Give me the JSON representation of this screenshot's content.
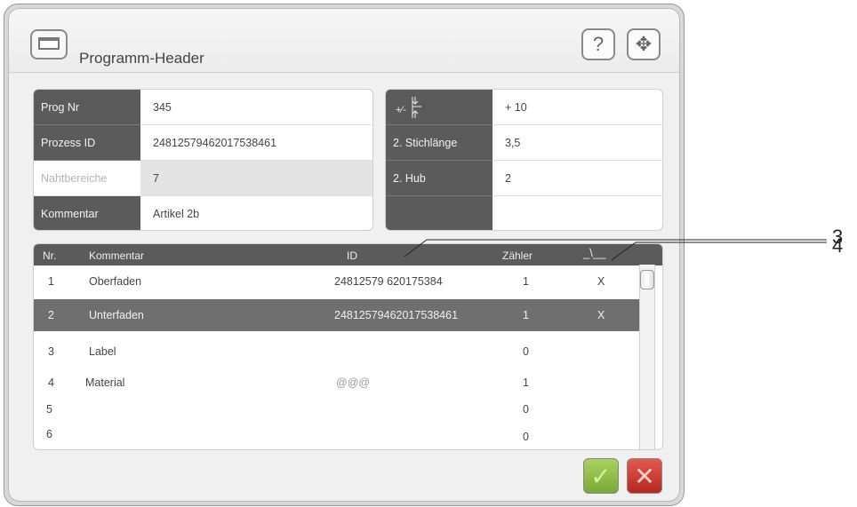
{
  "header": {
    "title": "Programm-Header",
    "help_icon": "?",
    "move_icon": "✥"
  },
  "left_table": [
    {
      "label": "Prog Nr",
      "value": "345"
    },
    {
      "label": "Prozess ID",
      "value": "24812579462017538461"
    },
    {
      "label": "Nahtbereiche",
      "value": "7"
    },
    {
      "label": "Kommentar",
      "value": "Artikel 2b"
    }
  ],
  "right_table": [
    {
      "label": "+/- stitch icon",
      "value": "+ 10"
    },
    {
      "label": "2. Stichlänge",
      "value": "3,5"
    },
    {
      "label": "2. Hub",
      "value": "2"
    },
    {
      "label": "",
      "value": ""
    }
  ],
  "list": {
    "columns": {
      "nr": "Nr.",
      "kommentar": "Kommentar",
      "id": "ID",
      "zaehler": "Zähler",
      "last": "_\\__"
    },
    "rows": [
      {
        "nr": "1",
        "kommentar": "Oberfaden",
        "id": "24812579  620175384",
        "zaehler": "1",
        "mark": "X"
      },
      {
        "nr": "2",
        "kommentar": "Unterfaden",
        "id": "24812579462017538461",
        "zaehler": "1",
        "mark": "X"
      },
      {
        "nr": "3",
        "kommentar": "Label",
        "id": "",
        "zaehler": "0",
        "mark": ""
      },
      {
        "nr": "4",
        "kommentar": "Material",
        "id": "@@@",
        "zaehler": "1",
        "mark": ""
      },
      {
        "nr": "5",
        "kommentar": "",
        "id": "",
        "zaehler": "0",
        "mark": ""
      },
      {
        "nr": "6",
        "kommentar": "",
        "id": "",
        "zaehler": "0",
        "mark": ""
      }
    ]
  },
  "footer": {
    "ok_icon": "✓",
    "cancel_icon": "✕"
  },
  "callouts": {
    "c3": "3",
    "c4": "4"
  },
  "colors": {
    "label_bg": "#5b5b5b",
    "selected_row": "#6f6f6f",
    "ok_green": "#8cbc45",
    "cancel_red": "#c8362c"
  }
}
